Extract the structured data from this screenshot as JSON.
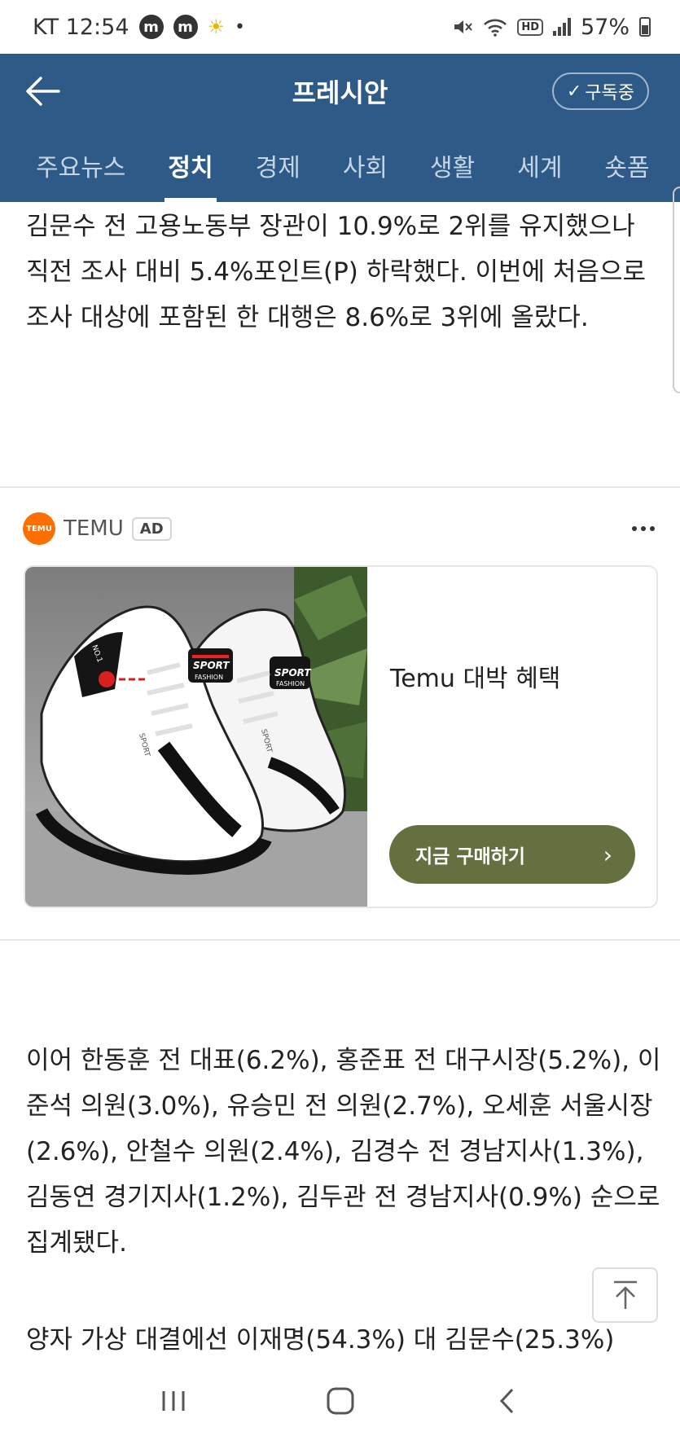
{
  "status_bar": {
    "carrier_time": "KT 12:54",
    "notif_1": "m",
    "notif_2": "m",
    "battery": "57%",
    "hd_label": "HD",
    "icons": [
      "mute-icon",
      "wifi-icon",
      "hd-icon",
      "signal-icon",
      "battery-icon",
      "sun-icon"
    ]
  },
  "header": {
    "title": "프레시안",
    "subscribe_label": "구독중"
  },
  "tabs": [
    {
      "label": "주요뉴스",
      "active": false
    },
    {
      "label": "정치",
      "active": true
    },
    {
      "label": "경제",
      "active": false
    },
    {
      "label": "사회",
      "active": false
    },
    {
      "label": "생활",
      "active": false
    },
    {
      "label": "세계",
      "active": false
    },
    {
      "label": "숏폼",
      "active": false
    }
  ],
  "article": {
    "paragraph_1": "김문수 전 고용노동부 장관이 10.9%로 2위를 유지했으나 직전 조사 대비 5.4%포인트(P) 하락했다. 이번에 처음으로 조사 대상에 포함된 한 대행은 8.6%로 3위에 올랐다.",
    "paragraph_2": "이어 한동훈 전 대표(6.2%), 홍준표 전 대구시장(5.2%), 이준석 의원(3.0%), 유승민 전 의원(2.7%), 오세훈 서울시장(2.6%), 안철수 의원(2.4%), 김경수 전 경남지사(1.3%), 김동연 경기지사(1.2%), 김두관 전 경남지사(0.9%) 순으로 집계됐다.",
    "paragraph_3": "양자 가상 대결에선 이재명(54.3%) 대 김문수(25.3%)"
  },
  "ad": {
    "brand": "TEMU",
    "badge": "AD",
    "logo_text": "TEMU",
    "title": "Temu 대박 혜택",
    "cta_label": "지금 구매하기",
    "image_text": {
      "shoe_brand": "SPORT",
      "shoe_sub": "FASHION",
      "shoe_tag": "NO.1"
    },
    "cta_color": "#64703f"
  },
  "colors": {
    "header_bg": "#2d5a86",
    "temu_orange": "#ff6f00"
  }
}
